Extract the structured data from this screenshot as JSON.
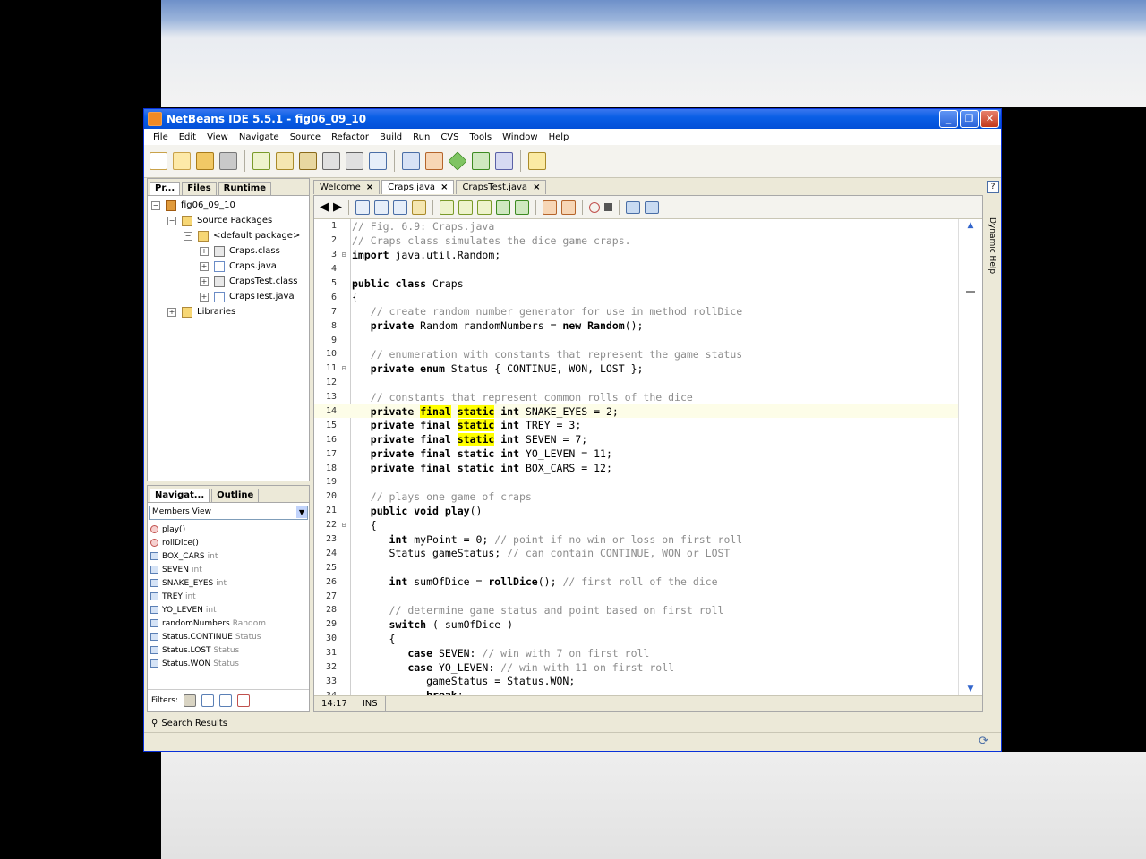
{
  "window": {
    "title": "NetBeans IDE 5.5.1 - fig06_09_10",
    "min": "_",
    "max": "❐",
    "close": "✕"
  },
  "menu": [
    "File",
    "Edit",
    "View",
    "Navigate",
    "Source",
    "Refactor",
    "Build",
    "Run",
    "CVS",
    "Tools",
    "Window",
    "Help"
  ],
  "projects_panel": {
    "tabs": [
      "Pr...",
      "Files",
      "Runtime"
    ],
    "tree": [
      {
        "label": "fig06_09_10",
        "indent": 0,
        "exp": "⊟",
        "icon": "proj"
      },
      {
        "label": "Source Packages",
        "indent": 1,
        "exp": "⊟",
        "icon": "folder"
      },
      {
        "label": "<default package>",
        "indent": 2,
        "exp": "⊟",
        "icon": "pkg"
      },
      {
        "label": "Craps.class",
        "indent": 3,
        "exp": "⊞",
        "icon": "cls"
      },
      {
        "label": "Craps.java",
        "indent": 3,
        "exp": "⊞",
        "icon": "java"
      },
      {
        "label": "CrapsTest.class",
        "indent": 3,
        "exp": "⊞",
        "icon": "cls"
      },
      {
        "label": "CrapsTest.java",
        "indent": 3,
        "exp": "⊞",
        "icon": "java"
      },
      {
        "label": "Libraries",
        "indent": 1,
        "exp": "⊞",
        "icon": "folder"
      }
    ]
  },
  "navigator": {
    "tabs": [
      "Navigat...",
      "Outline"
    ],
    "view": "Members View",
    "members": [
      {
        "name": "play()",
        "type": "",
        "kind": "method"
      },
      {
        "name": "rollDice()",
        "type": "",
        "kind": "method"
      },
      {
        "name": "BOX_CARS",
        "type": "int",
        "kind": "field"
      },
      {
        "name": "SEVEN",
        "type": "int",
        "kind": "field"
      },
      {
        "name": "SNAKE_EYES",
        "type": "int",
        "kind": "field"
      },
      {
        "name": "TREY",
        "type": "int",
        "kind": "field"
      },
      {
        "name": "YO_LEVEN",
        "type": "int",
        "kind": "field"
      },
      {
        "name": "randomNumbers",
        "type": "Random",
        "kind": "field"
      },
      {
        "name": "Status.CONTINUE",
        "type": "Status",
        "kind": "field"
      },
      {
        "name": "Status.LOST",
        "type": "Status",
        "kind": "field"
      },
      {
        "name": "Status.WON",
        "type": "Status",
        "kind": "field"
      }
    ],
    "filters_label": "Filters:"
  },
  "editor": {
    "tabs": [
      "Welcome",
      "Craps.java",
      "CrapsTest.java"
    ],
    "cursor_position": "14:17",
    "mode": "INS"
  },
  "dynamic_help": "Dynamic Help",
  "search_results": "Search Results"
}
